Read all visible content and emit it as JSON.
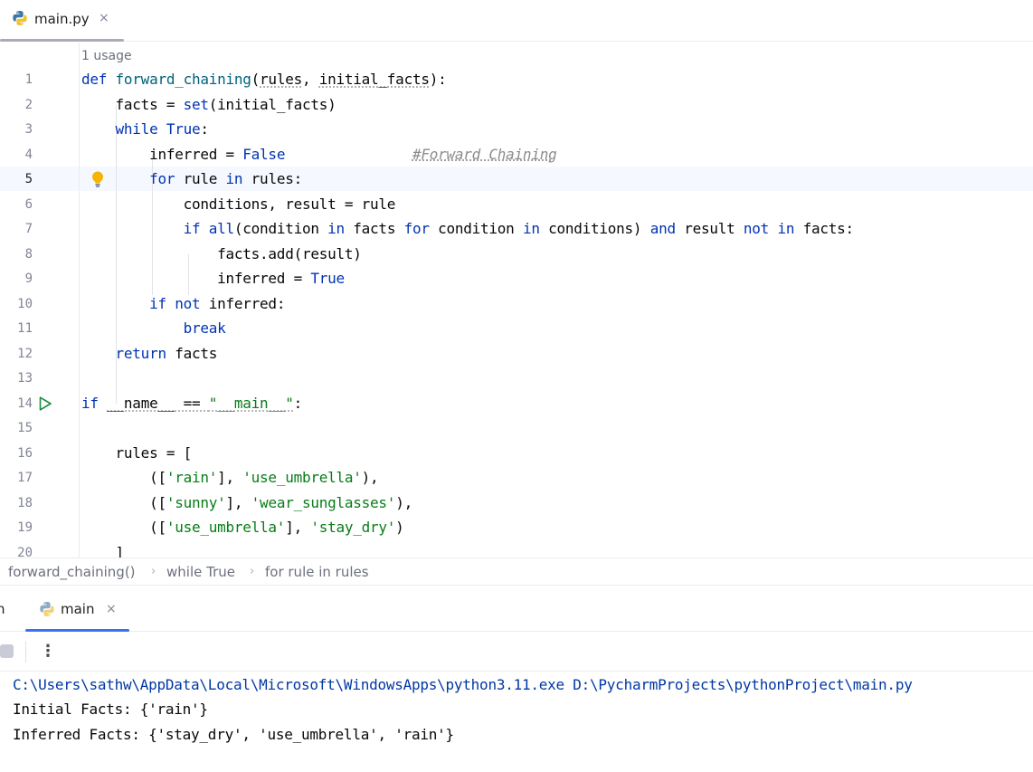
{
  "editor_tab": {
    "label": "main.py",
    "close": "×"
  },
  "editor": {
    "usage_hint": "1 usage",
    "line_numbers": [
      "1",
      "2",
      "3",
      "4",
      "5",
      "6",
      "7",
      "8",
      "9",
      "10",
      "11",
      "12",
      "13",
      "14",
      "15",
      "16",
      "17",
      "18",
      "19",
      "20"
    ],
    "lines": {
      "l1": {
        "def": "def ",
        "fn": "forward_chaining",
        "open": "(",
        "p1": "rules",
        "comma": ", ",
        "p2": "initial_facts",
        "close": "):"
      },
      "l2": {
        "a": "facts = ",
        "fn": "set",
        "b": "(initial_facts)"
      },
      "l3": {
        "kw": "while ",
        "kw2": "True",
        "b": ":"
      },
      "l4": {
        "a": "inferred = ",
        "kw": "False",
        "pad": "               ",
        "comment": "#Forward Chaining"
      },
      "l5": {
        "kw": "for ",
        "a": "rule ",
        "kw2": "in ",
        "b": "rules:"
      },
      "l6": {
        "a": "conditions, result = rule"
      },
      "l7": {
        "kw": "if ",
        "fn": "all",
        "a": "(condition ",
        "kw2": "in ",
        "b": "facts ",
        "kw3": "for ",
        "c": "condition ",
        "kw4": "in ",
        "d": "conditions) ",
        "kw5": "and ",
        "e": "result ",
        "kw6": "not in ",
        "f": "facts:"
      },
      "l8": {
        "a": "facts.add(result)"
      },
      "l9": {
        "a": "inferred = ",
        "kw": "True"
      },
      "l10": {
        "kw": "if not ",
        "a": "inferred:"
      },
      "l11": {
        "kw": "break"
      },
      "l12": {
        "kw": "return ",
        "a": "facts"
      },
      "l14": {
        "kw": "if ",
        "name": "__name__",
        "a": " == ",
        "str": "\"__main__\"",
        "b": ":"
      },
      "l16": {
        "a": "rules = ["
      },
      "l17": {
        "a": "([",
        "s1": "'rain'",
        "b": "], ",
        "s2": "'use_umbrella'",
        "c": "),"
      },
      "l18": {
        "a": "([",
        "s1": "'sunny'",
        "b": "], ",
        "s2": "'wear_sunglasses'",
        "c": "),"
      },
      "l19": {
        "a": "([",
        "s1": "'use_umbrella'",
        "b": "], ",
        "s2": "'stay_dry'",
        "c": ")"
      },
      "l20": {
        "a": "]"
      }
    }
  },
  "breadcrumb": [
    "forward_chaining()",
    "while True",
    "for rule in rules"
  ],
  "breadcrumb_sep": "›",
  "run_window": {
    "clipped_tab": "n",
    "tab": {
      "label": "main",
      "close": "×"
    },
    "more": "⋮"
  },
  "console": {
    "command": "C:\\Users\\sathw\\AppData\\Local\\Microsoft\\WindowsApps\\python3.11.exe D:\\PycharmProjects\\pythonProject\\main.py",
    "line1": "Initial Facts: {'rain'}",
    "line2": "Inferred Facts: {'stay_dry', 'use_umbrella', 'rain'}"
  },
  "colors": {
    "keyword": "#0033b3",
    "function": "#00627a",
    "string": "#067d17",
    "comment": "#8c8c8c",
    "accent": "#3574f0"
  },
  "icons": {
    "file": "python-icon",
    "hint": "lightbulb-icon",
    "run": "run-gutter-icon",
    "stop": "stop-icon",
    "more": "more-vertical-icon"
  }
}
